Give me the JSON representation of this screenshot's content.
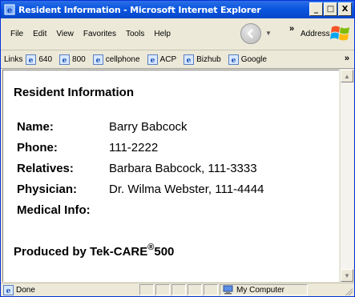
{
  "window": {
    "title": "Resident Information - Microsoft Internet Explorer",
    "minimize": "_",
    "maximize": "□",
    "close": "X"
  },
  "menu": {
    "items": [
      "File",
      "Edit",
      "View",
      "Favorites",
      "Tools",
      "Help"
    ],
    "chevron": "»",
    "address_label": "Address"
  },
  "links": {
    "label": "Links",
    "items": [
      "640",
      "800",
      "cellphone",
      "ACP",
      "Bizhub",
      "Google"
    ],
    "chevron": "»"
  },
  "page": {
    "title": "Resident Information",
    "fields": [
      {
        "label": "Name:",
        "value": "Barry Babcock"
      },
      {
        "label": "Phone:",
        "value": "111-2222"
      },
      {
        "label": "Relatives:",
        "value": "Barbara Babcock, 111-3333"
      },
      {
        "label": "Physician:",
        "value": "Dr. Wilma Webster, 111-4444"
      },
      {
        "label": "Medical Info:",
        "value": ""
      }
    ],
    "produced_prefix": "Produced by Tek-CARE",
    "produced_mark": "®",
    "produced_suffix": "500"
  },
  "status": {
    "text": "Done",
    "zone": "My Computer"
  },
  "colors": {
    "titlebar": "#0a56e0",
    "chrome": "#ece9d8"
  }
}
